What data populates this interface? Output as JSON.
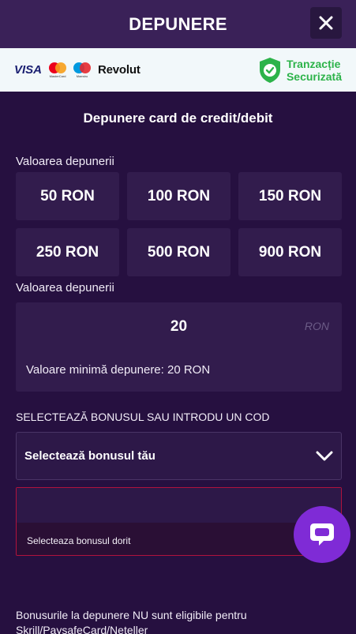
{
  "header": {
    "title": "DEPUNERE",
    "close_icon": "close-icon"
  },
  "payment_band": {
    "logos": {
      "visa": "VISA",
      "mastercard_label": "MasterCard",
      "maestro_label": "Maestro",
      "revolut": "Revolut"
    },
    "secure_line1": "Tranzacție",
    "secure_line2": "Securizată",
    "secure_color": "#2db34a"
  },
  "main": {
    "subtitle": "Depunere card de credit/debit",
    "amount_label": "Valoarea depunerii",
    "amounts": [
      "50 RON",
      "100 RON",
      "150 RON",
      "250 RON",
      "500 RON",
      "900 RON"
    ],
    "custom_label": "Valoarea depunerii",
    "custom_value": "20",
    "currency": "RON",
    "min_note": "Valoare minimă depunere: 20 RON",
    "bonus_heading": "SELECTEAZĂ BONUSUL SAU INTRODU UN COD",
    "bonus_select": "Selectează bonusul tău",
    "code_error": "Selecteaza bonusul dorit",
    "footnote": "Bonusurile la depunere NU sunt eligibile pentru Skrill/PaysafeCard/Neteller"
  },
  "colors": {
    "accent": "#7f2bd6",
    "error": "#b0123d",
    "background": "#241238"
  }
}
